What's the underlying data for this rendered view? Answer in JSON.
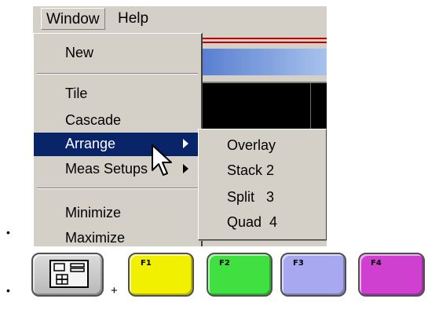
{
  "bullets": [
    "•",
    "•"
  ],
  "menubar": {
    "items": [
      {
        "label": "Window"
      },
      {
        "label": "Help"
      }
    ]
  },
  "window_menu": {
    "items": [
      {
        "label": "New"
      },
      {
        "label": "Tile"
      },
      {
        "label": "Cascade"
      },
      {
        "label": "Arrange",
        "submenu": true,
        "selected": true
      },
      {
        "label": "Meas Setups",
        "submenu": true
      },
      {
        "label": "Minimize"
      },
      {
        "label": "Maximize"
      }
    ]
  },
  "arrange_submenu": {
    "items": [
      {
        "label": "Overlay"
      },
      {
        "label": "Stack 2"
      },
      {
        "label": "Split   3"
      },
      {
        "label": "Quad  4"
      }
    ]
  },
  "keys": {
    "plus": "+",
    "layout_key_icon": "window-layout-icon",
    "function_keys": [
      {
        "label": "F1",
        "color": "#f0f000"
      },
      {
        "label": "F2",
        "color": "#40e040"
      },
      {
        "label": "F3",
        "color": "#a8a8f0"
      },
      {
        "label": "F4",
        "color": "#d040d0"
      }
    ]
  },
  "colors": {
    "menu_bg": "#d4d0c8",
    "selection": "#0a246a",
    "titlebar": "#5a7fd0"
  }
}
